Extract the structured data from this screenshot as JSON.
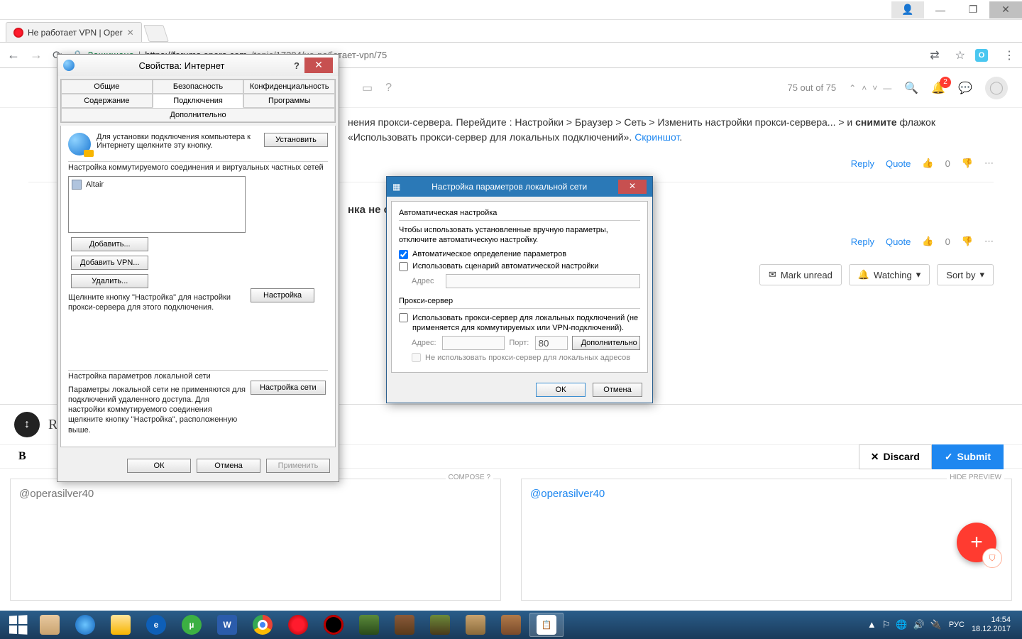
{
  "win": {
    "user": "",
    "min": "—",
    "max": "❐",
    "close": "✕"
  },
  "tab": {
    "title": "Не работает VPN | Oper",
    "close": "✕"
  },
  "addr": {
    "back": "←",
    "fwd": "→",
    "reload": "⟳",
    "secure": "Защищено",
    "sep": " | ",
    "host": "https://forums.opera.com",
    "path": "/topic/17294/не-работает-vpn/75",
    "translate": "⇄",
    "star": "☆",
    "menu": "⋮"
  },
  "forum": {
    "book": "▭",
    "help": "?",
    "pager": "75 out of 75",
    "notif": "2",
    "search": "🔍",
    "bell": "🔔",
    "chat": "💬"
  },
  "post1": {
    "text_a": "нения прокси-сервера. Перейдите : Настройки > Браузер > Сеть > Изменить настройки прокси-сервера... >  и ",
    "bold": "снимите",
    "text_b": " флажок «Использовать прокси-сервер для локальных подключений». ",
    "link": "Скриншот",
    "dot": "."
  },
  "actions": {
    "reply": "Reply",
    "quote": "Quote",
    "up": "👍",
    "zero": "0",
    "down": "👎",
    "more": "⋯"
  },
  "post2": {
    "text": "нка не ст"
  },
  "topicbtns": {
    "unread": "Mark unread",
    "watch": "Watching",
    "sort": "Sort by",
    "unread_icon": "✉",
    "watch_icon": "🔔",
    "caret": "▾"
  },
  "composer": {
    "avatar": "↕",
    "title": "Replyi",
    "bold": "B",
    "discard": "Discard",
    "discard_icon": "✕",
    "submit": "Submit",
    "submit_icon": "✓",
    "compose": "COMPOSE",
    "compose_q": "?",
    "preview": "HIDE PREVIEW",
    "mention": "@operasilver40"
  },
  "fab": "+",
  "dlg1": {
    "title": "Свойства: Интернет",
    "help": "?",
    "close": "✕",
    "tabs": [
      "Общие",
      "Безопасность",
      "Конфиденциальность",
      "Содержание",
      "Подключения",
      "Программы",
      "Дополнительно"
    ],
    "active_tab": 4,
    "install_text": "Для установки подключения компьютера к Интернету щелкните эту кнопку.",
    "install_btn": "Установить",
    "group1": "Настройка коммутируемого соединения и виртуальных частных сетей",
    "conn_item": "Altair",
    "btns": [
      "Добавить...",
      "Добавить VPN...",
      "Удалить...",
      "Настройка"
    ],
    "hint1": "Щелкните кнопку \"Настройка\" для настройки прокси-сервера для этого подключения.",
    "group2": "Настройка параметров локальной сети",
    "hint2": "Параметры локальной сети не применяются для подключений удаленного доступа. Для настройки коммутируемого соединения щелкните кнопку \"Настройка\", расположенную выше.",
    "lan_btn": "Настройка сети",
    "ok": "ОК",
    "cancel": "Отмена",
    "apply": "Применить"
  },
  "dlg2": {
    "title": "Настройка параметров локальной сети",
    "close": "✕",
    "g1": "Автоматическая настройка",
    "g1_text": "Чтобы использовать установленные вручную параметры, отключите автоматическую настройку.",
    "chk1": "Автоматическое определение параметров",
    "chk2": "Использовать сценарий автоматической настройки",
    "addr_lbl": "Адрес",
    "g2": "Прокси-сервер",
    "chk3": "Использовать прокси-сервер для локальных подключений (не применяется для коммутируемых или VPN-подключений).",
    "addr2_lbl": "Адрес:",
    "port_lbl": "Порт:",
    "port_val": "80",
    "adv": "Дополнительно",
    "chk4": "Не использовать прокси-сервер для локальных адресов",
    "ok": "ОК",
    "cancel": "Отмена"
  },
  "taskbar": {
    "icons_colors": [
      "#d8b080",
      "#1e90ff",
      "#f7b500",
      "#1e90ff",
      "#3cb043",
      "#2b5cab",
      "#fff",
      "#ff1b2d",
      "#000",
      "#3a6b2a",
      "#7a3b1a",
      "#6b4a2a",
      "#8a5a2a",
      "#fff"
    ],
    "lang": "РУС",
    "time": "14:54",
    "date": "18.12.2017",
    "tray": [
      "▲",
      "⚐",
      "🌐",
      "🔊",
      "🔌"
    ]
  }
}
